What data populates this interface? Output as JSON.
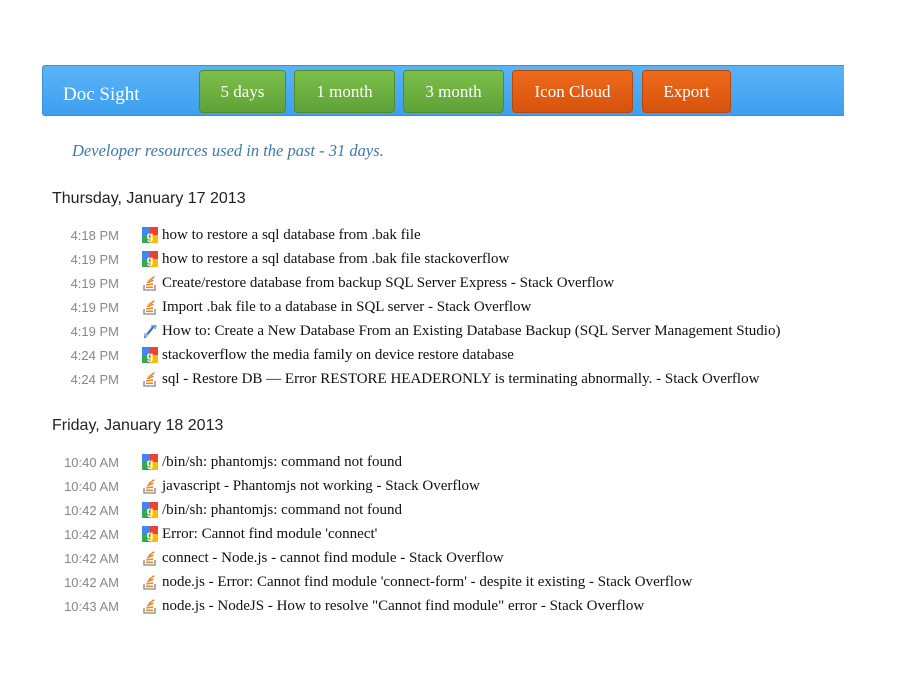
{
  "app": {
    "brand": "Doc Sight"
  },
  "nav": {
    "buttons": [
      {
        "label": "5 days"
      },
      {
        "label": "1 month"
      },
      {
        "label": "3 month"
      },
      {
        "label": "Icon Cloud"
      },
      {
        "label": "Export"
      }
    ]
  },
  "subtitle": "Developer resources used in the past - 31 days.",
  "days": [
    {
      "heading": "Thursday, January 17 2013",
      "entries": [
        {
          "time": "4:18 PM",
          "icon": "google-icon",
          "title": "how to restore a sql database from .bak file"
        },
        {
          "time": "4:19 PM",
          "icon": "google-icon",
          "title": "how to restore a sql database from .bak file stackoverflow"
        },
        {
          "time": "4:19 PM",
          "icon": "stackoverflow-icon",
          "title": "Create/restore database from backup SQL Server Express - Stack Overflow"
        },
        {
          "time": "4:19 PM",
          "icon": "stackoverflow-icon",
          "title": "Import .bak file to a database in SQL server - Stack Overflow"
        },
        {
          "time": "4:19 PM",
          "icon": "msdn-icon",
          "title": "How to: Create a New Database From an Existing Database Backup (SQL Server Management Studio)"
        },
        {
          "time": "4:24 PM",
          "icon": "google-icon",
          "title": "stackoverflow the media family on device restore database"
        },
        {
          "time": "4:24 PM",
          "icon": "stackoverflow-icon",
          "title": "sql - Restore DB — Error RESTORE HEADERONLY is terminating abnormally. - Stack Overflow"
        }
      ]
    },
    {
      "heading": "Friday, January 18 2013",
      "entries": [
        {
          "time": "10:40 AM",
          "icon": "google-icon",
          "title": "/bin/sh: phantomjs: command not found"
        },
        {
          "time": "10:40 AM",
          "icon": "stackoverflow-icon",
          "title": "javascript - Phantomjs not working - Stack Overflow"
        },
        {
          "time": "10:42 AM",
          "icon": "google-icon",
          "title": "/bin/sh: phantomjs: command not found"
        },
        {
          "time": "10:42 AM",
          "icon": "google-icon",
          "title": "Error: Cannot find module 'connect'"
        },
        {
          "time": "10:42 AM",
          "icon": "stackoverflow-icon",
          "title": "connect - Node.js - cannot find module - Stack Overflow"
        },
        {
          "time": "10:42 AM",
          "icon": "stackoverflow-icon",
          "title": "node.js - Error: Cannot find module 'connect-form' - despite it existing - Stack Overflow"
        },
        {
          "time": "10:43 AM",
          "icon": "stackoverflow-icon",
          "title": "node.js - NodeJS - How to resolve \"Cannot find module\" error - Stack Overflow"
        }
      ]
    }
  ],
  "colors": {
    "topbar": "#4aa8f4",
    "green_button": "#6caf3f",
    "orange_button": "#e0600f",
    "subtitle": "#3f78a6"
  }
}
